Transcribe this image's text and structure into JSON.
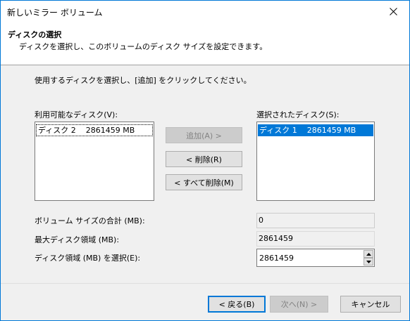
{
  "window": {
    "title": "新しいミラー ボリューム"
  },
  "header": {
    "title": "ディスクの選択",
    "subtitle": "ディスクを選択し、このボリュームのディスク サイズを設定できます。"
  },
  "instruction": "使用するディスクを選択し、[追加] をクリックしてください。",
  "available": {
    "label": "利用可能なディスク(V):",
    "items": [
      {
        "text": "ディスク 2    2861459 MB"
      }
    ]
  },
  "selected": {
    "label": "選択されたディスク(S):",
    "items": [
      {
        "text": "ディスク 1    2861459 MB"
      }
    ]
  },
  "buttons": {
    "add": "追加(A) >",
    "remove": "< 削除(R)",
    "remove_all": "< すべて削除(M)",
    "back": "< 戻る(B)",
    "next": "次へ(N) >",
    "cancel": "キャンセル"
  },
  "fields": {
    "total_label": "ボリューム サイズの合計 (MB):",
    "total_value": "0",
    "max_label": "最大ディスク領域 (MB):",
    "max_value": "2861459",
    "select_label": "ディスク領域 (MB) を選択(E):",
    "select_value": "2861459"
  },
  "colors": {
    "accent": "#0078d7",
    "selection": "#0078d7"
  },
  "icons": {
    "close": "close-icon",
    "spin_up": "chevron-up-icon",
    "spin_down": "chevron-down-icon"
  }
}
